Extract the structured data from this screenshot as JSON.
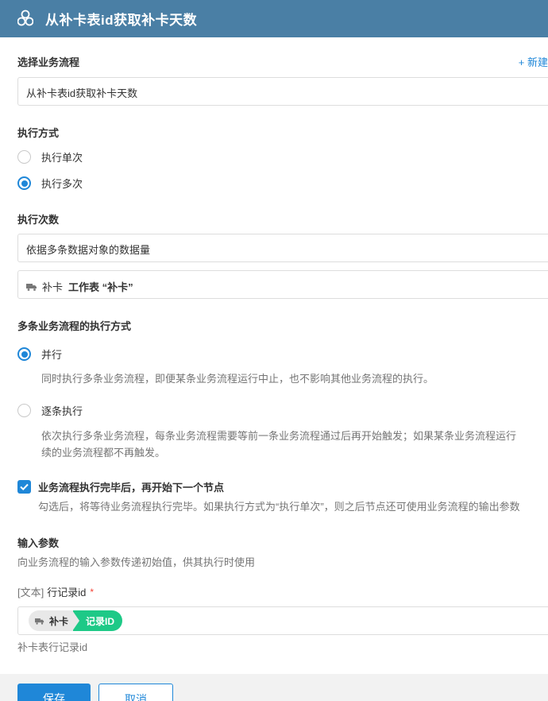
{
  "header": {
    "title": "从补卡表id获取补卡天数",
    "icon": "hexagon-cluster-icon"
  },
  "workflow_select": {
    "label": "选择业务流程",
    "new_link": "+ 新建",
    "value": "从补卡表id获取补卡天数"
  },
  "exec_mode": {
    "label": "执行方式",
    "options": [
      {
        "label": "执行单次",
        "selected": false
      },
      {
        "label": "执行多次",
        "selected": true
      }
    ]
  },
  "exec_count": {
    "label": "执行次数",
    "value": "依据多条数据对象的数据量",
    "source": {
      "icon": "truck-icon",
      "sheet": "补卡",
      "text": "工作表 “补卡”"
    }
  },
  "multi_mode": {
    "label": "多条业务流程的执行方式",
    "options": [
      {
        "label": "并行",
        "selected": true,
        "desc": "同时执行多条业务流程，即便某条业务流程运行中止，也不影响其他业务流程的执行。"
      },
      {
        "label": "逐条执行",
        "selected": false,
        "desc_line1": "依次执行多条业务流程，每条业务流程需要等前一条业务流程通过后再开始触发；如果某条业务流程运行",
        "desc_line2": "续的业务流程都不再触发。"
      }
    ]
  },
  "wait_option": {
    "checked": true,
    "label": "业务流程执行完毕后，再开始下一个节点",
    "desc": "勾选后，将等待业务流程执行完毕。如果执行方式为“执行单次”，则之后节点还可使用业务流程的输出参数"
  },
  "input_params": {
    "label": "输入参数",
    "desc": "向业务流程的输入参数传递初始值，供其执行时使用",
    "param": {
      "type_label": "[文本]",
      "name": "行记录id",
      "required_mark": "*",
      "tag_sheet": "补卡",
      "tag_field": "记录ID",
      "tag_icon": "truck-icon",
      "note": "补卡表行记录id"
    }
  },
  "buttons": {
    "save": "保存",
    "cancel": "取消"
  },
  "colors": {
    "header_bg": "#4a7fa5",
    "accent": "#1f87d8",
    "tag_green": "#1ec987",
    "required": "#f44336"
  }
}
